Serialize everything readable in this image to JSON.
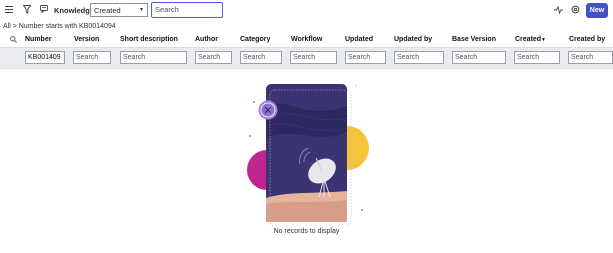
{
  "toolbar": {
    "menu_icon": "hamburger-menu-icon",
    "filter_icon": "funnel-icon",
    "chat_icon": "chat-bubble-icon",
    "title": "Knowledge",
    "sort_select_value": "Created",
    "search_placeholder": "Search",
    "new_label": "New",
    "spark_icon": "activity-icon",
    "settings_icon": "gear-icon"
  },
  "breadcrumb": "All > Number starts with KB0014094",
  "columns": [
    "Number",
    "Version",
    "Short description",
    "Author",
    "Category",
    "Workflow",
    "Updated",
    "Updated by",
    "Base Version",
    "Created",
    "Created by"
  ],
  "sorted_column_indicator": "▼",
  "filters": {
    "number_value": "KB001409",
    "placeholder": "Search"
  },
  "empty_state": {
    "message": "No records to display",
    "illustration": "satellite-dish-night-sky",
    "colors": {
      "navy": "#3a3473",
      "magenta": "#c0268f",
      "yellow": "#f4c43d",
      "sand": "#e6b39b",
      "purple": "#8a6fd1"
    }
  }
}
